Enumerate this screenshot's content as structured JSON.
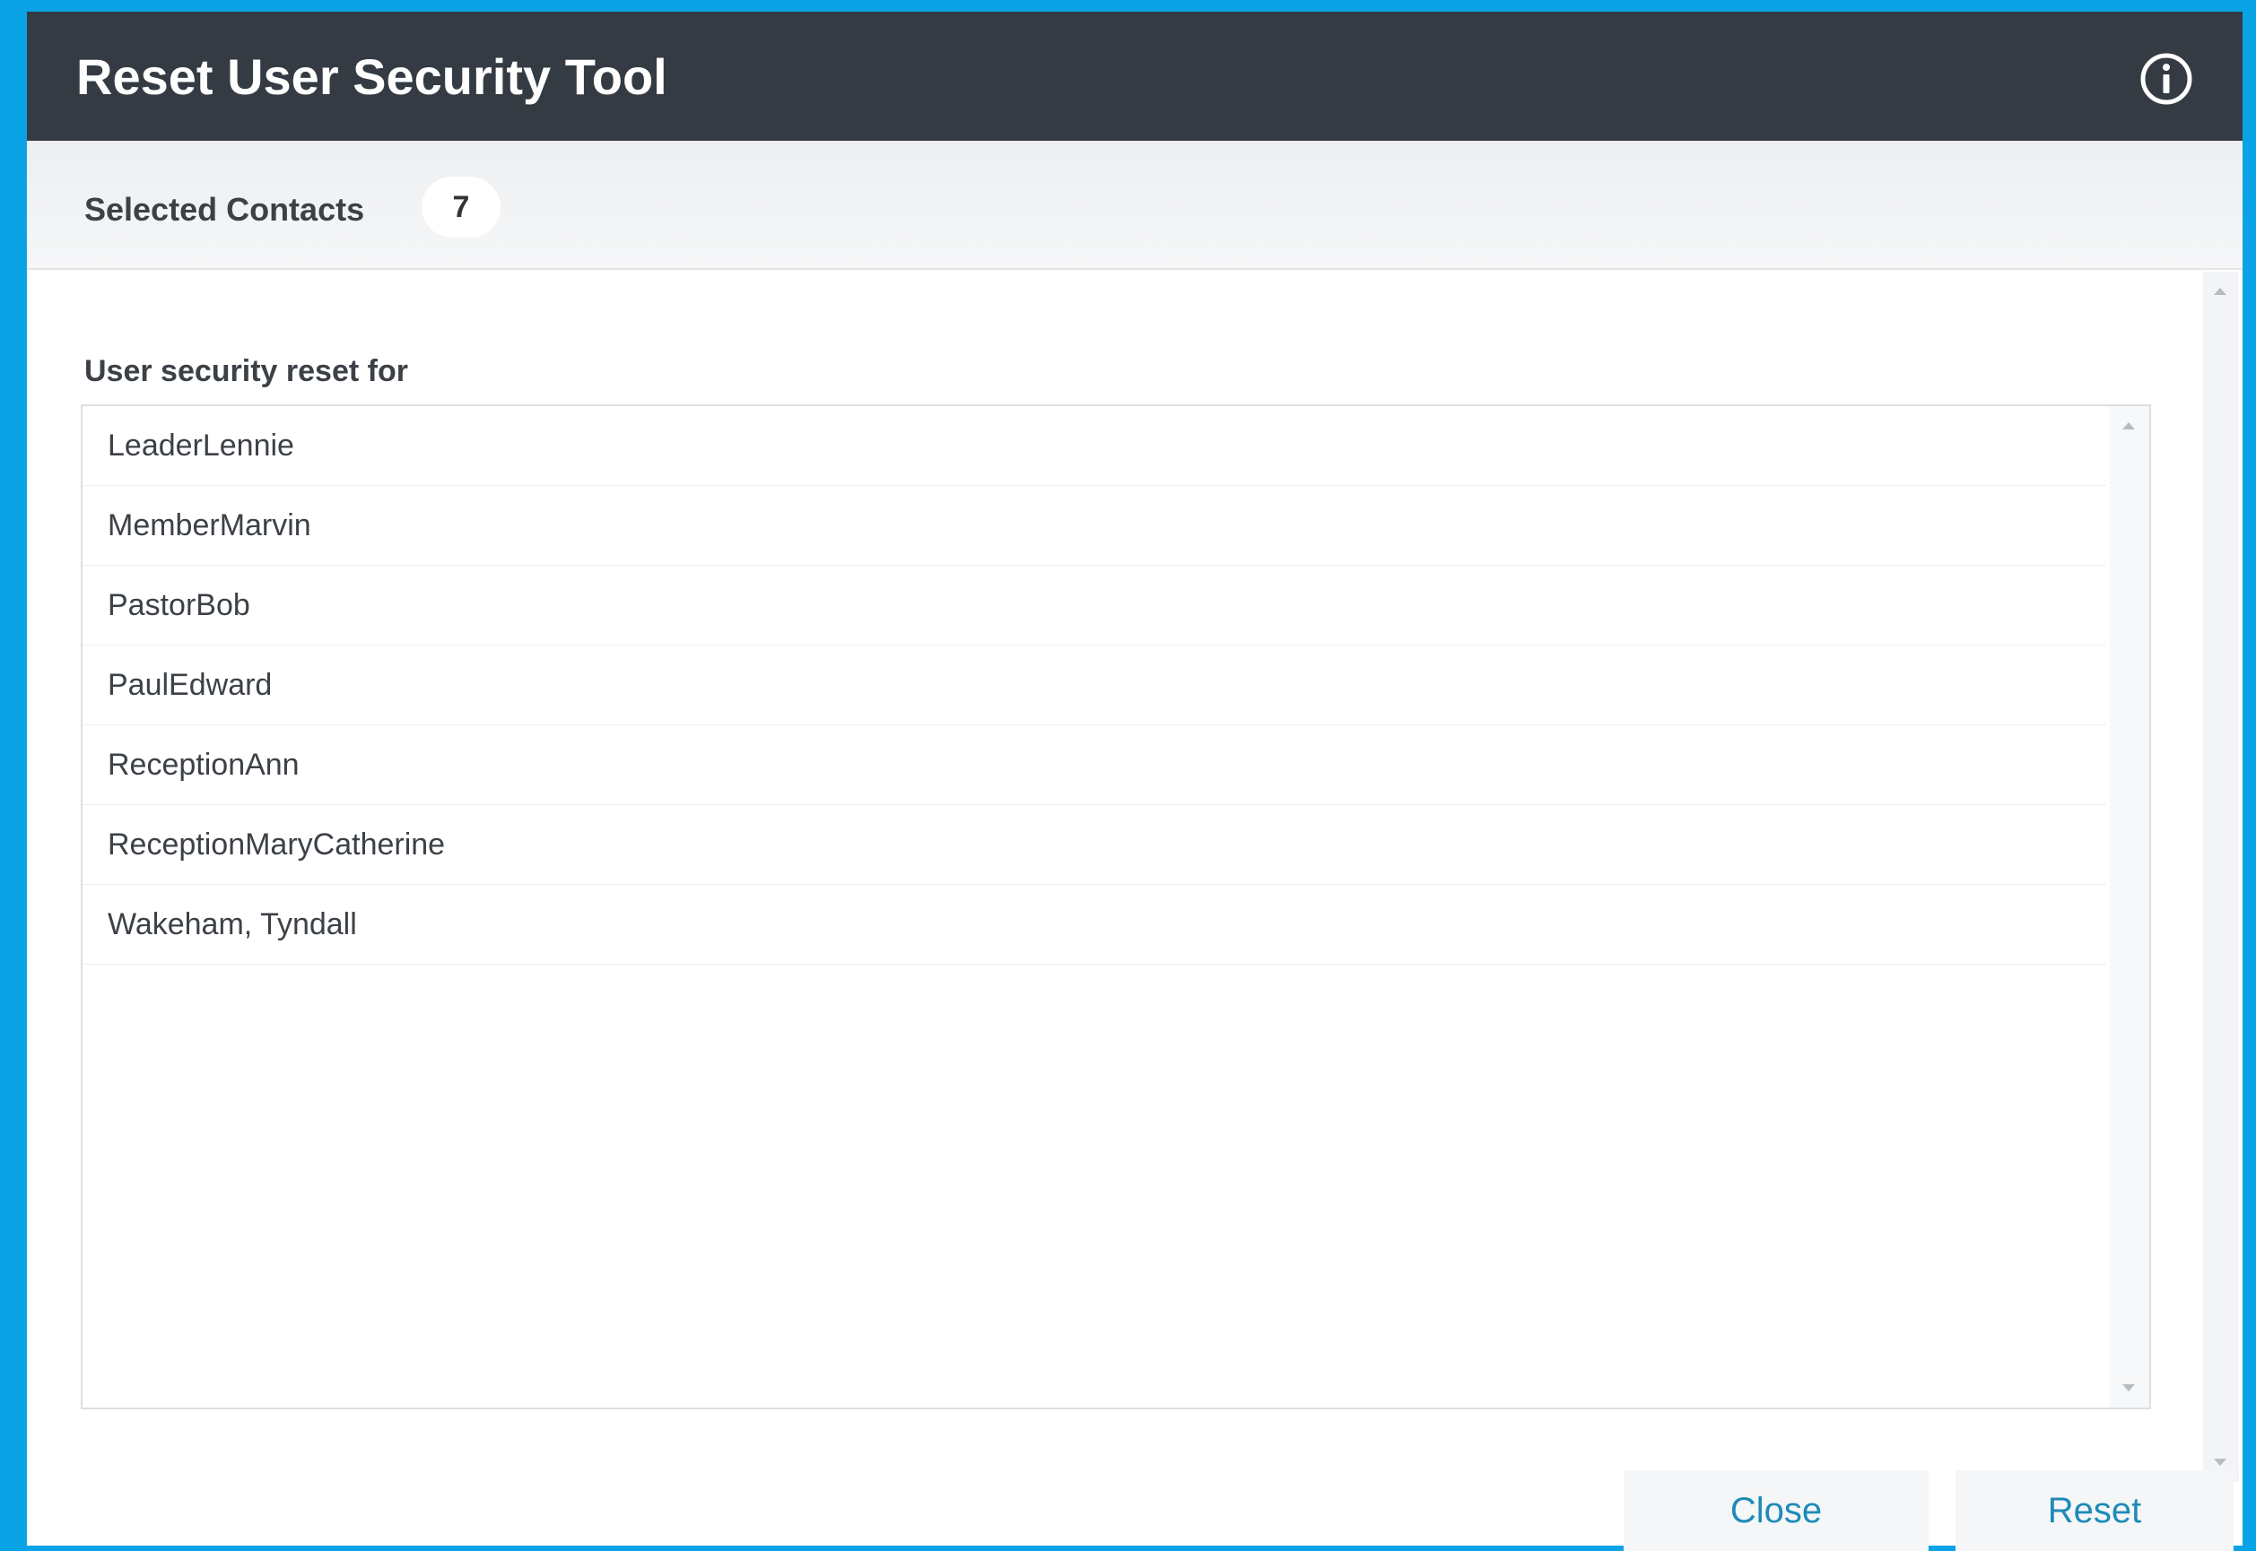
{
  "dialog": {
    "title": "Reset User Security Tool",
    "info_icon": "info-circle-icon"
  },
  "subheader": {
    "label": "Selected Contacts",
    "count": "7"
  },
  "section": {
    "label": "User security reset for"
  },
  "users": [
    "LeaderLennie",
    "MemberMarvin",
    "PastorBob",
    "PaulEdward",
    "ReceptionAnn",
    "ReceptionMaryCatherine",
    "Wakeham, Tyndall"
  ],
  "footer": {
    "close_label": "Close",
    "reset_label": "Reset"
  },
  "colors": {
    "background": "#0aa3e6",
    "titlebar": "#343b43",
    "button_text": "#1d8bb8"
  }
}
